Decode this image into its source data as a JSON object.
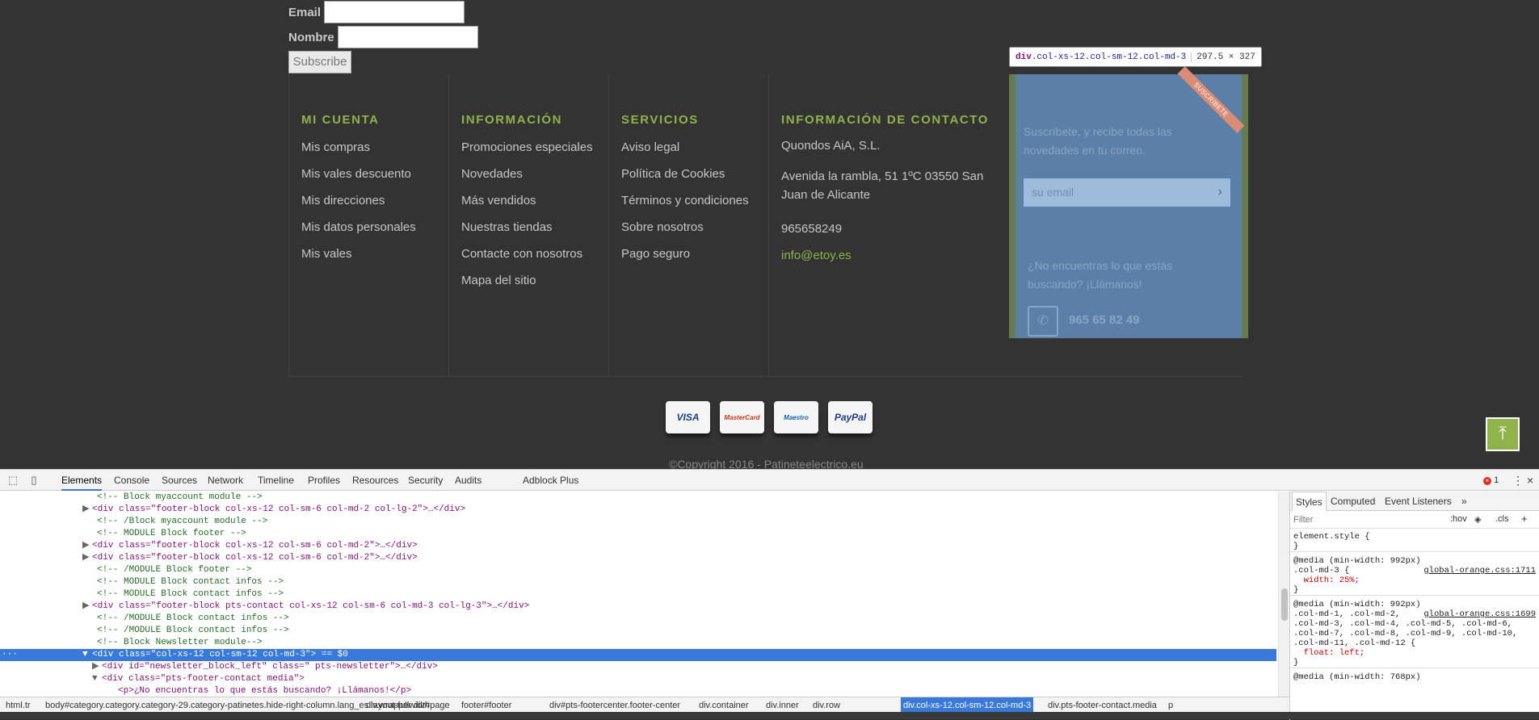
{
  "newsletter_form": {
    "email_label": "Email",
    "name_label": "Nombre",
    "subscribe_label": "Subscribe"
  },
  "footer": {
    "account": {
      "title": "MI CUENTA",
      "items": [
        "Mis compras",
        "Mis vales descuento",
        "Mis direcciones",
        "Mis datos personales",
        "Mis vales"
      ]
    },
    "info": {
      "title": "INFORMACIÓN",
      "items": [
        "Promociones especiales",
        "Novedades",
        "Más vendidos",
        "Nuestras tiendas",
        "Contacte con nosotros",
        "Mapa del sitio"
      ]
    },
    "services": {
      "title": "SERVICIOS",
      "items": [
        "Aviso legal",
        "Política de Cookies",
        "Términos y condiciones",
        "Sobre nosotros",
        "Pago seguro"
      ]
    },
    "contact": {
      "title": "INFORMACIÓN DE CONTACTO",
      "company": "Quondos AiA, S.L.",
      "address": "Avenida la rambla, 51 1ºC 03550 San Juan de Alicante",
      "phone": "965658249",
      "email": "info@etoy.es"
    },
    "payments": [
      "VISA",
      "MasterCard",
      "Maestro",
      "PayPal"
    ],
    "copyright": "©Copyright 2016 - Patineteelectrico.eu"
  },
  "highlight": {
    "tooltip_tag": "div",
    "tooltip_class": ".col-xs-12.col-sm-12.col-md-3",
    "tooltip_size": "297.5 × 327",
    "subscribe_text": "Suscríbete, y recibe todas las novedades en tu correo.",
    "email_placeholder": "su email",
    "ribbon": "SUSCRÍBETE",
    "call_text": "¿No encuentras lo que estás buscando? ¡Llámanos!",
    "phone": "965 65 82 49"
  },
  "devtools": {
    "tabs": [
      "Elements",
      "Console",
      "Sources",
      "Network",
      "Timeline",
      "Profiles",
      "Resources",
      "Security",
      "Audits",
      "Adblock Plus"
    ],
    "error_count": "1",
    "dom_lines": [
      {
        "kind": "comment",
        "text": "<!-- Block myaccount module -->"
      },
      {
        "kind": "el",
        "text": "<div class=\"footer-block col-xs-12 col-sm-6 col-md-2 col-lg-2\">…</div>"
      },
      {
        "kind": "comment",
        "text": "<!-- /Block myaccount module -->"
      },
      {
        "kind": "comment",
        "text": "<!-- MODULE Block footer -->"
      },
      {
        "kind": "el",
        "text": "<div class=\"footer-block col-xs-12 col-sm-6 col-md-2\">…</div>"
      },
      {
        "kind": "el",
        "text": "<div class=\"footer-block col-xs-12 col-sm-6 col-md-2\">…</div>"
      },
      {
        "kind": "comment",
        "text": "<!-- /MODULE Block footer -->"
      },
      {
        "kind": "comment",
        "text": "<!-- MODULE Block contact infos -->"
      },
      {
        "kind": "comment",
        "text": "<!-- MODULE Block contact infos -->"
      },
      {
        "kind": "el",
        "text": "<div class=\"footer-block pts-contact col-xs-12 col-sm-6 col-md-3 col-lg-3\">…</div>"
      },
      {
        "kind": "comment",
        "text": "<!-- /MODULE Block contact infos -->"
      },
      {
        "kind": "comment",
        "text": "<!-- /MODULE Block contact infos -->"
      },
      {
        "kind": "comment",
        "text": "<!-- Block Newsletter module-->"
      },
      {
        "kind": "selected",
        "text": "<div class=\"col-xs-12 col-sm-12 col-md-3\"> == $0"
      },
      {
        "kind": "el",
        "text": "<div id=\"newsletter_block_left\" class=\" pts-newsletter\">…</div>"
      },
      {
        "kind": "el",
        "text": "<div class=\"pts-footer-contact media\">"
      },
      {
        "kind": "el",
        "text": "<p>¿No encuentras lo que estás buscando? ¡Llámanos!</p>"
      }
    ],
    "breadcrumbs": [
      "html.tr",
      "body#category.category.category-29.category-patinetes.hide-right-column.lang_es.layout-fullwidth",
      "div.wrapper",
      "div#page",
      "footer#footer",
      "div#pts-footercenter.footer-center",
      "div.container",
      "div.inner",
      "div.row",
      "div.col-xs-12.col-sm-12.col-md-3",
      "div.pts-footer-contact.media",
      "p"
    ],
    "styles_tabs": [
      "Styles",
      "Computed",
      "Event Listeners"
    ],
    "filter_placeholder": "Filter",
    "hov": ":hov",
    "cls": ".cls",
    "css_rules": [
      {
        "line": "element.style {",
        "src": ""
      },
      {
        "line": "}",
        "src": ""
      },
      {
        "line": "@media (min-width: 992px)",
        "src": ""
      },
      {
        "line": ".col-md-3 {",
        "src": "global-orange.css:1711"
      },
      {
        "line": "  width: 25%;",
        "src": ""
      },
      {
        "line": "}",
        "src": ""
      },
      {
        "line": "@media (min-width: 992px)",
        "src": ""
      },
      {
        "line": ".col-md-1, .col-md-2,",
        "src": "global-orange.css:1699"
      },
      {
        "line": ".col-md-3, .col-md-4, .col-md-5, .col-md-6,",
        "src": ""
      },
      {
        "line": ".col-md-7, .col-md-8, .col-md-9, .col-md-10,",
        "src": ""
      },
      {
        "line": ".col-md-11, .col-md-12 {",
        "src": ""
      },
      {
        "line": "  float: left;",
        "src": ""
      },
      {
        "line": "}",
        "src": ""
      },
      {
        "line": "@media (min-width: 768px)",
        "src": ""
      }
    ]
  }
}
